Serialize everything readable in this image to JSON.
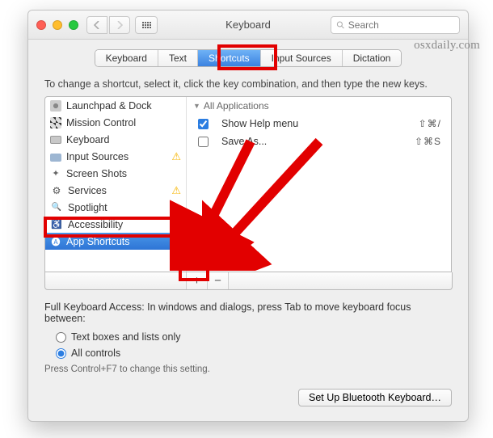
{
  "window_title": "Keyboard",
  "search_placeholder": "Search",
  "watermark": "osxdaily.com",
  "tabs": [
    {
      "label": "Keyboard",
      "selected": false
    },
    {
      "label": "Text",
      "selected": false
    },
    {
      "label": "Shortcuts",
      "selected": true
    },
    {
      "label": "Input Sources",
      "selected": false
    },
    {
      "label": "Dictation",
      "selected": false
    }
  ],
  "instruction": "To change a shortcut, select it, click the key combination, and then type the new keys.",
  "categories": [
    {
      "label": "Launchpad & Dock",
      "icon": "launchpad-icon",
      "warn": false
    },
    {
      "label": "Mission Control",
      "icon": "mission-control-icon",
      "warn": false
    },
    {
      "label": "Keyboard",
      "icon": "keyboard-icon",
      "warn": false
    },
    {
      "label": "Input Sources",
      "icon": "input-sources-icon",
      "warn": true
    },
    {
      "label": "Screen Shots",
      "icon": "screenshots-icon",
      "warn": false
    },
    {
      "label": "Services",
      "icon": "services-icon",
      "warn": true
    },
    {
      "label": "Spotlight",
      "icon": "spotlight-icon",
      "warn": false
    },
    {
      "label": "Accessibility",
      "icon": "accessibility-icon",
      "warn": false
    },
    {
      "label": "App Shortcuts",
      "icon": "app-shortcuts-icon",
      "warn": false,
      "selected": true
    }
  ],
  "group_header": "All Applications",
  "shortcut_rows": [
    {
      "checked": true,
      "label": "Show Help menu",
      "keys": "⇧⌘/"
    },
    {
      "checked": false,
      "label": "Save As...",
      "keys": "⇧⌘S"
    }
  ],
  "plus_label": "+",
  "minus_label": "−",
  "fka_text": "Full Keyboard Access: In windows and dialogs, press Tab to move keyboard focus between:",
  "radios": [
    {
      "label": "Text boxes and lists only",
      "checked": false
    },
    {
      "label": "All controls",
      "checked": true
    }
  ],
  "hint2": "Press Control+F7 to change this setting.",
  "bottom_button": "Set Up Bluetooth Keyboard…"
}
